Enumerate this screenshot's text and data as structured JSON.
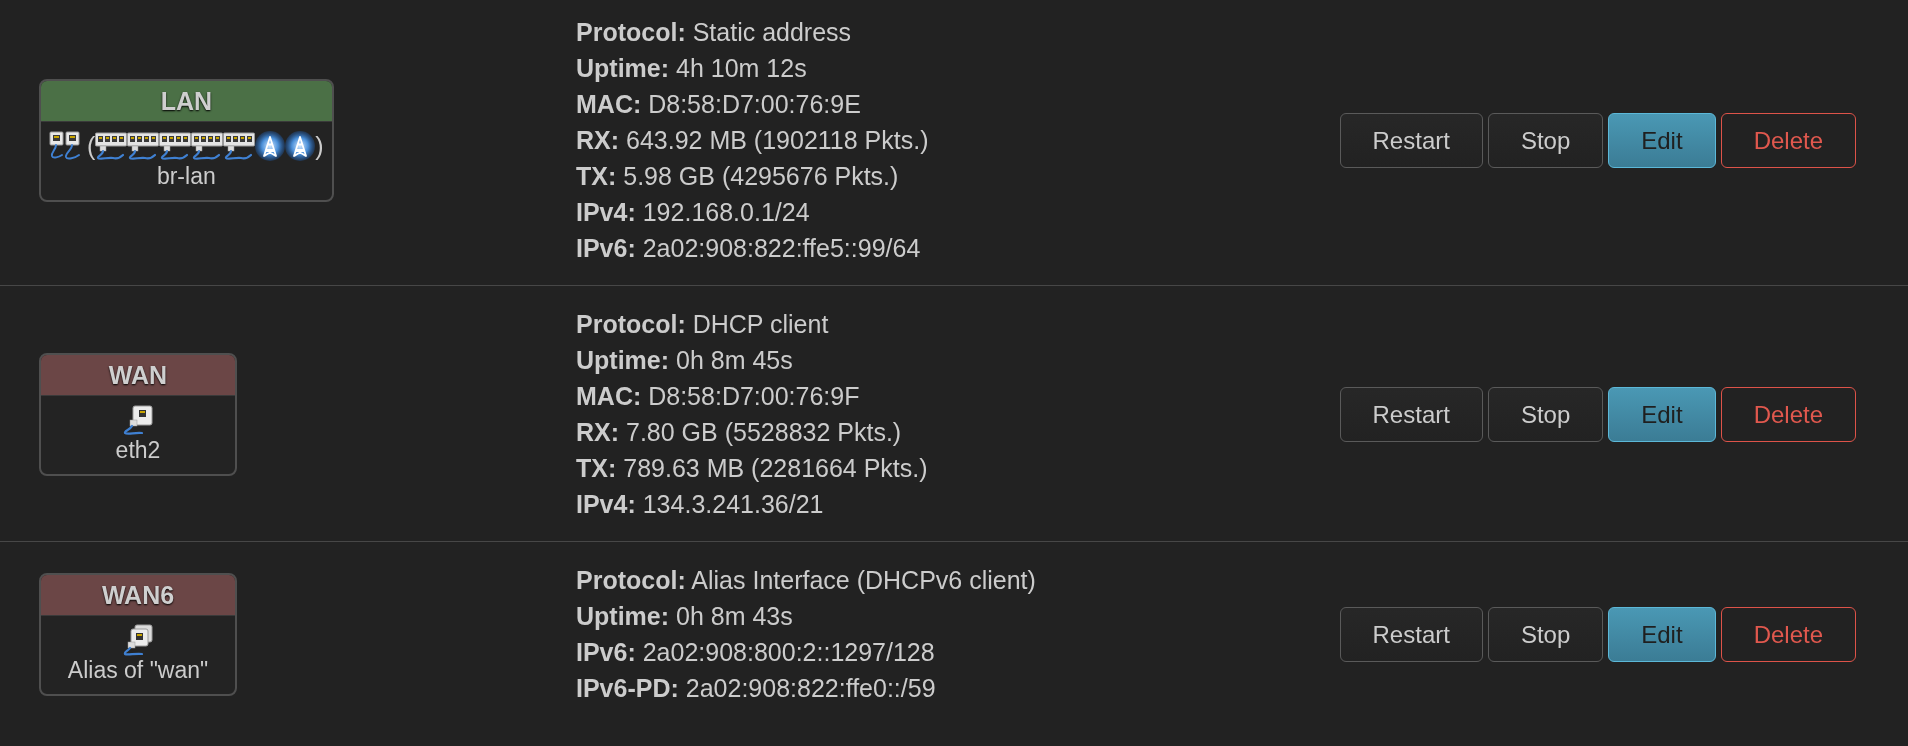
{
  "interfaces": [
    {
      "name": "LAN",
      "color": "#4b7046",
      "devices": {
        "kind": "bridge",
        "open": "(",
        "members": [
          {
            "kind": "ethernet"
          },
          {
            "kind": "ethernet"
          },
          {
            "kind": "ethernet"
          },
          {
            "kind": "ethernet"
          },
          {
            "kind": "ethernet"
          },
          {
            "kind": "wireless"
          },
          {
            "kind": "wireless"
          }
        ],
        "close": ")"
      },
      "device_name": "br-lan",
      "details": [
        {
          "label": "Protocol:",
          "value": "Static address"
        },
        {
          "label": "Uptime:",
          "value": "4h 10m 12s"
        },
        {
          "label": "MAC:",
          "value": "D8:58:D7:00:76:9E"
        },
        {
          "label": "RX:",
          "value": "643.92 MB (1902118 Pkts.)"
        },
        {
          "label": "TX:",
          "value": "5.98 GB (4295676 Pkts.)"
        },
        {
          "label": "IPv4:",
          "value": "192.168.0.1/24"
        },
        {
          "label": "IPv6:",
          "value": "2a02:908:822:ffe5::99/64"
        }
      ],
      "buttons": [
        {
          "kind": "restart",
          "label": "Restart"
        },
        {
          "kind": "stop",
          "label": "Stop"
        },
        {
          "kind": "edit",
          "label": "Edit"
        },
        {
          "kind": "delete",
          "label": "Delete"
        }
      ]
    },
    {
      "name": "WAN",
      "color": "#6b4646",
      "devices": {
        "kind": "ethernet"
      },
      "device_name": "eth2",
      "details": [
        {
          "label": "Protocol:",
          "value": "DHCP client"
        },
        {
          "label": "Uptime:",
          "value": "0h 8m 45s"
        },
        {
          "label": "MAC:",
          "value": "D8:58:D7:00:76:9F"
        },
        {
          "label": "RX:",
          "value": "7.80 GB (5528832 Pkts.)"
        },
        {
          "label": "TX:",
          "value": "789.63 MB (2281664 Pkts.)"
        },
        {
          "label": "IPv4:",
          "value": "134.3.241.36/21"
        }
      ],
      "buttons": [
        {
          "kind": "restart",
          "label": "Restart"
        },
        {
          "kind": "stop",
          "label": "Stop"
        },
        {
          "kind": "edit",
          "label": "Edit"
        },
        {
          "kind": "delete",
          "label": "Delete"
        }
      ]
    },
    {
      "name": "WAN6",
      "color": "#6b4646",
      "devices": {
        "kind": "alias"
      },
      "device_name": "Alias of \"wan\"",
      "details": [
        {
          "label": "Protocol:",
          "value": "Alias Interface (DHCPv6 client)"
        },
        {
          "label": "Uptime:",
          "value": "0h 8m 43s"
        },
        {
          "label": "IPv6:",
          "value": "2a02:908:800:2::1297/128"
        },
        {
          "label": "IPv6-PD:",
          "value": "2a02:908:822:ffe0::/59"
        }
      ],
      "buttons": [
        {
          "kind": "restart",
          "label": "Restart"
        },
        {
          "kind": "stop",
          "label": "Stop"
        },
        {
          "kind": "edit",
          "label": "Edit"
        },
        {
          "kind": "delete",
          "label": "Delete"
        }
      ]
    }
  ]
}
